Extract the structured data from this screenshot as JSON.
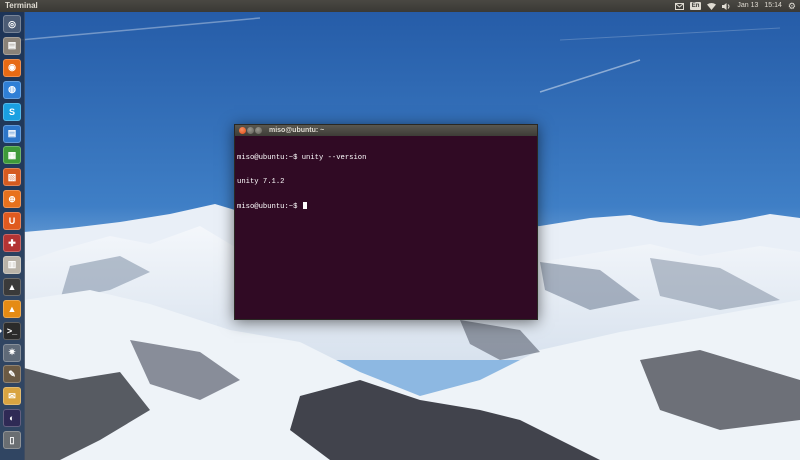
{
  "top_panel": {
    "app_title": "Terminal",
    "keyboard_layout": "En",
    "date": "Jan 13",
    "time": "15:14"
  },
  "terminal": {
    "title": "miso@ubuntu: ~",
    "lines": [
      "miso@ubuntu:~$ unity --version",
      "unity 7.1.2",
      "miso@ubuntu:~$ "
    ]
  },
  "launcher": {
    "items": [
      {
        "name": "dash-home-icon",
        "color": "#4b5b74",
        "glyph": "◎"
      },
      {
        "name": "files-icon",
        "color": "#8a8278",
        "glyph": "▤"
      },
      {
        "name": "firefox-icon",
        "color": "#e76a14",
        "glyph": "◉"
      },
      {
        "name": "chromium-icon",
        "color": "#2f7fd6",
        "glyph": "◍"
      },
      {
        "name": "skype-icon",
        "color": "#1aa0e1",
        "glyph": "S"
      },
      {
        "name": "libreoffice-writer-icon",
        "color": "#2d76c9",
        "glyph": "▤"
      },
      {
        "name": "libreoffice-calc-icon",
        "color": "#3e9a3a",
        "glyph": "▦"
      },
      {
        "name": "libreoffice-impress-icon",
        "color": "#d55b20",
        "glyph": "▧"
      },
      {
        "name": "ubuntu-software-center-icon",
        "color": "#e8711d",
        "glyph": "⊕"
      },
      {
        "name": "ubuntu-one-icon",
        "color": "#e05a1f",
        "glyph": "U"
      },
      {
        "name": "system-settings-icon",
        "color": "#b33434",
        "glyph": "✚"
      },
      {
        "name": "gparted-icon",
        "color": "#b9b3a9",
        "glyph": "▥"
      },
      {
        "name": "inkscape-icon",
        "color": "#3a3a3a",
        "glyph": "▲"
      },
      {
        "name": "vlc-icon",
        "color": "#e58b14",
        "glyph": "▲"
      },
      {
        "name": "terminal-icon",
        "color": "#2b2b2b",
        "glyph": ">_",
        "running": true
      },
      {
        "name": "settings-gear-icon",
        "color": "#5f6a78",
        "glyph": "✷"
      },
      {
        "name": "gimp-icon",
        "color": "#6b5a44",
        "glyph": "✎"
      },
      {
        "name": "mail-icon",
        "color": "#d9a441",
        "glyph": "✉"
      },
      {
        "name": "eclipse-icon",
        "color": "#2f2a55",
        "glyph": "◐"
      },
      {
        "name": "trash-icon",
        "color": "#6a6e72",
        "glyph": "▯"
      }
    ]
  }
}
